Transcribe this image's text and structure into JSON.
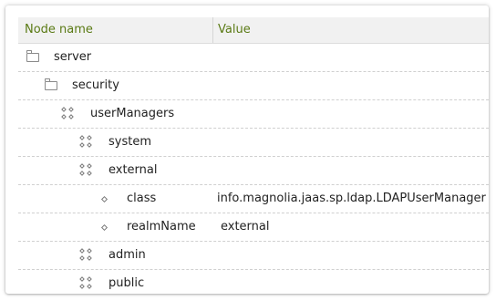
{
  "header": {
    "name_label": "Node name",
    "value_label": "Value"
  },
  "rows": [
    {
      "label": "server",
      "value": "",
      "icon": "folder-icon"
    },
    {
      "label": "security",
      "value": "",
      "icon": "folder-icon"
    },
    {
      "label": "userManagers",
      "value": "",
      "icon": "content-node-icon"
    },
    {
      "label": "system",
      "value": "",
      "icon": "content-node-icon"
    },
    {
      "label": "external",
      "value": "",
      "icon": "content-node-icon"
    },
    {
      "label": "class",
      "value": "info.magnolia.jaas.sp.ldap.LDAPUserManager",
      "icon": "property-icon"
    },
    {
      "label": "realmName",
      "value": "external",
      "icon": "property-icon"
    },
    {
      "label": "admin",
      "value": "",
      "icon": "content-node-icon"
    },
    {
      "label": "public",
      "value": "",
      "icon": "content-node-icon"
    }
  ]
}
